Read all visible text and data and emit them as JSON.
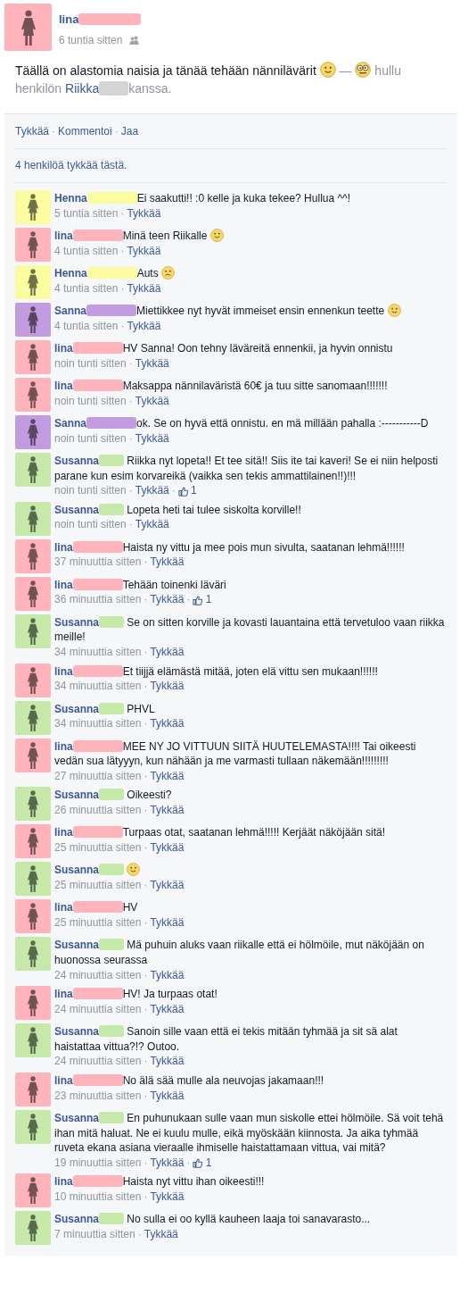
{
  "separator": "·",
  "post": {
    "author": "lina",
    "color": "#ffb3ba",
    "time": "6 tuntia sitten",
    "text": "Täällä on alastomia naisia ja tänää tehään nännilävärit",
    "emoji": {
      "kind": "smile"
    },
    "dash": "—",
    "feeling_emoji": {
      "kind": "crazy"
    },
    "feeling": "hullu",
    "with_prefix": "henkilön",
    "tagged": "Riikka",
    "with_suffix": "kanssa."
  },
  "actions": [
    "Tykkää",
    "Kommentoi",
    "Jaa"
  ],
  "likes_summary": "4 henkilöä tykkää tästä.",
  "comments": [
    {
      "author": "Henna",
      "color": "#fbfba0",
      "text": "Ei saakutti!! :0 kelle ja kuka tekee? Hullua ^^!",
      "time": "5 tuntia sitten",
      "like": "Tykkää"
    },
    {
      "author": "lina",
      "color": "#ffb3ba",
      "text": "Minä teen Riikalle",
      "emoji": {
        "kind": "smile"
      },
      "time": "4 tuntia sitten",
      "like": "Tykkää"
    },
    {
      "author": "Henna",
      "color": "#fbfba0",
      "text": "Auts",
      "emoji": {
        "kind": "frown"
      },
      "time": "4 tuntia sitten",
      "like": "Tykkää"
    },
    {
      "author": "Sanna",
      "color": "#c39be0",
      "text": "Miettikkee nyt hyvät immeiset ensin ennenkun teette",
      "emoji": {
        "kind": "smile"
      },
      "time": "4 tuntia sitten",
      "like": "Tykkää"
    },
    {
      "author": "lina",
      "color": "#ffb3ba",
      "text": "HV Sanna! Oon tehny läväreitä ennenkii, ja hyvin onnistu",
      "time": "noin tunti sitten",
      "like": "Tykkää"
    },
    {
      "author": "lina",
      "color": "#ffb3ba",
      "text": "Maksappa nännilaväristä 60€ ja tuu sitte sanomaan!!!!!!!",
      "time": "noin tunti sitten",
      "like": "Tykkää"
    },
    {
      "author": "Sanna",
      "color": "#c39be0",
      "text": "ok. Se on hyvä että onnistu. en mä millään pahalla :-----------D",
      "time": "noin tunti sitten",
      "like": "Tykkää"
    },
    {
      "author": "Susanna",
      "color": "#c6e9a9",
      "text": "Riikka nyt lopeta!! Et tee sitä!! Siis ite tai kaveri! Se ei niin helposti parane kun esim korvareikä (vaikka sen tekis ammattilainen!!)!!!",
      "time": "noin tunti sitten",
      "like": "Tykkää",
      "likes": "1"
    },
    {
      "author": "Susanna",
      "color": "#c6e9a9",
      "text": "Lopeta heti tai tulee siskolta korville!!",
      "time": "noin tunti sitten",
      "like": "Tykkää"
    },
    {
      "author": "lina",
      "color": "#ffb3ba",
      "text": "Haista ny vittu ja mee pois mun sivulta, saatanan lehmä!!!!!!",
      "time": "37 minuuttia sitten",
      "like": "Tykkää"
    },
    {
      "author": "lina",
      "color": "#ffb3ba",
      "text": "Tehään toinenki läväri",
      "time": "36 minuuttia sitten",
      "like": "Tykkää",
      "likes": "1"
    },
    {
      "author": "Susanna",
      "color": "#c6e9a9",
      "text": "Se on sitten korville ja kovasti lauantaina että tervetuloo vaan riikka meille!",
      "time": "34 minuuttia sitten",
      "like": "Tykkää"
    },
    {
      "author": "lina",
      "color": "#ffb3ba",
      "text": "Et tiijjä elämästä mitää, joten elä vittu sen mukaan!!!!!!",
      "time": "34 minuuttia sitten",
      "like": "Tykkää"
    },
    {
      "author": "Susanna",
      "color": "#c6e9a9",
      "text": "PHVL",
      "time": "34 minuuttia sitten",
      "like": "Tykkää"
    },
    {
      "author": "lina",
      "color": "#ffb3ba",
      "text": "MEE NY JO VITTUUN SIITÄ HUUTELEMASTA!!!! Tai oikeesti vedän sua lätyyyn, kun nähään ja me varmasti tullaan näkemään!!!!!!!!!",
      "time": "27 minuuttia sitten",
      "like": "Tykkää"
    },
    {
      "author": "Susanna",
      "color": "#c6e9a9",
      "text": "Oikeesti?",
      "time": "26 minuuttia sitten",
      "like": "Tykkää"
    },
    {
      "author": "lina",
      "color": "#ffb3ba",
      "text": "Turpaas otat, saatanan lehmä!!!!! Kerjäät näköjään sitä!",
      "time": "25 minuuttia sitten",
      "like": "Tykkää"
    },
    {
      "author": "Susanna",
      "color": "#c6e9a9",
      "emoji": {
        "kind": "smile"
      },
      "time": "25 minuuttia sitten",
      "like": "Tykkää"
    },
    {
      "author": "lina",
      "color": "#ffb3ba",
      "text": "HV",
      "time": "25 minuuttia sitten",
      "like": "Tykkää"
    },
    {
      "author": "Susanna",
      "color": "#c6e9a9",
      "text": "Mä puhuin aluks vaan riikalle että ei hölmöile, mut näköjään on huonossa seurassa",
      "time": "24 minuuttia sitten",
      "like": "Tykkää"
    },
    {
      "author": "lina",
      "color": "#ffb3ba",
      "text": "HV! Ja turpaas otat!",
      "time": "24 minuuttia sitten",
      "like": "Tykkää"
    },
    {
      "author": "Susanna",
      "color": "#c6e9a9",
      "text": "Sanoin sille vaan että ei tekis mitään tyhmää ja sit sä alat haistattaa vittua?!? Outoo.",
      "time": "24 minuuttia sitten",
      "like": "Tykkää"
    },
    {
      "author": "lina",
      "color": "#ffb3ba",
      "text": "No älä sää mulle ala neuvojas jakamaan!!!",
      "time": "23 minuuttia sitten",
      "like": "Tykkää"
    },
    {
      "author": "Susanna",
      "color": "#c6e9a9",
      "text": "En puhunukaan sulle vaan mun siskolle ettei hölmöile. Sä voit tehä ihan mitä haluat. Ne ei kuulu mulle, eikä myöskään kiinnosta. Ja aika tyhmää ruveta ekana asiana vieraalle ihmiselle haistattamaan vittua, vai mitä?",
      "time": "19 minuuttia sitten",
      "like": "Tykkää",
      "likes": "1"
    },
    {
      "author": "lina",
      "color": "#ffb3ba",
      "text": "Haista nyt vittu ihan oikeesti!!!",
      "time": "10 minuuttia sitten",
      "like": "Tykkää"
    },
    {
      "author": "Susanna",
      "color": "#c6e9a9",
      "text": "No sulla ei oo kyllä kauheen laaja toi sanavarasto...",
      "time": "7 minuuttia sitten",
      "like": "Tykkää"
    }
  ]
}
